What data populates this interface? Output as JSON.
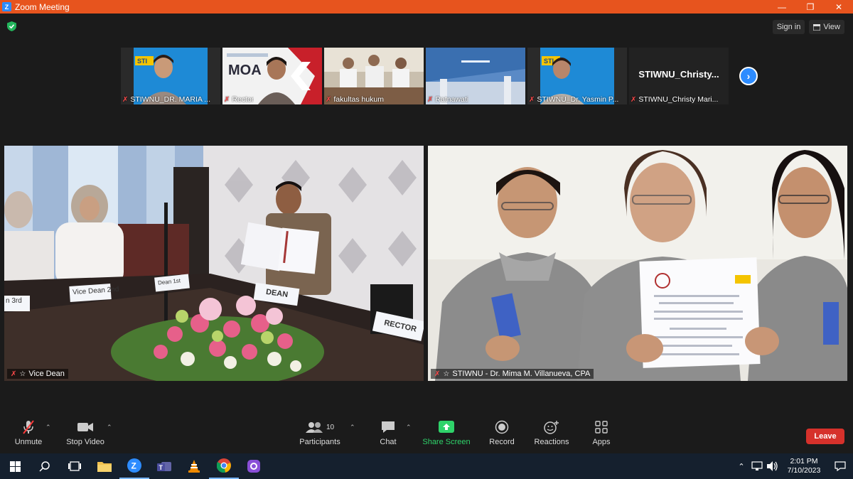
{
  "window": {
    "title": "Zoom Meeting"
  },
  "top_bar": {
    "sign_in": "Sign in",
    "view": "View"
  },
  "thumbnails": [
    {
      "name": "STIWNU_DR. MARIA ..."
    },
    {
      "name": "Rector",
      "banner": "MOA"
    },
    {
      "name": "fakultas hukum"
    },
    {
      "name": "Ratnawati"
    },
    {
      "name": "STIWNU_Dr. Yasmin P..."
    },
    {
      "name": "STIWNU_Christy Mari...",
      "display_name": "STIWNU_Christy..."
    }
  ],
  "main_videos": {
    "left": {
      "name": "Vice Dean",
      "placards": {
        "vice_dean": "Vice Dean 2nd",
        "vice_dean_left": "n 3rd",
        "vice_dean_back": "Dean 1st",
        "dean": "DEAN",
        "rector": "RECTOR"
      }
    },
    "right": {
      "name": "STIWNU - Dr. Mima M. Villanueva, CPA"
    }
  },
  "toolbar": {
    "unmute": "Unmute",
    "stop_video": "Stop Video",
    "participants": "Participants",
    "participants_count": "10",
    "chat": "Chat",
    "share_screen": "Share Screen",
    "record": "Record",
    "reactions": "Reactions",
    "apps": "Apps",
    "leave": "Leave"
  },
  "taskbar": {
    "time": "2:01 PM",
    "date": "7/10/2023"
  },
  "colors": {
    "title_bar": "#e7541e",
    "accent": "#2d8cff",
    "share_green": "#2fd36a",
    "leave_red": "#d6312b"
  }
}
